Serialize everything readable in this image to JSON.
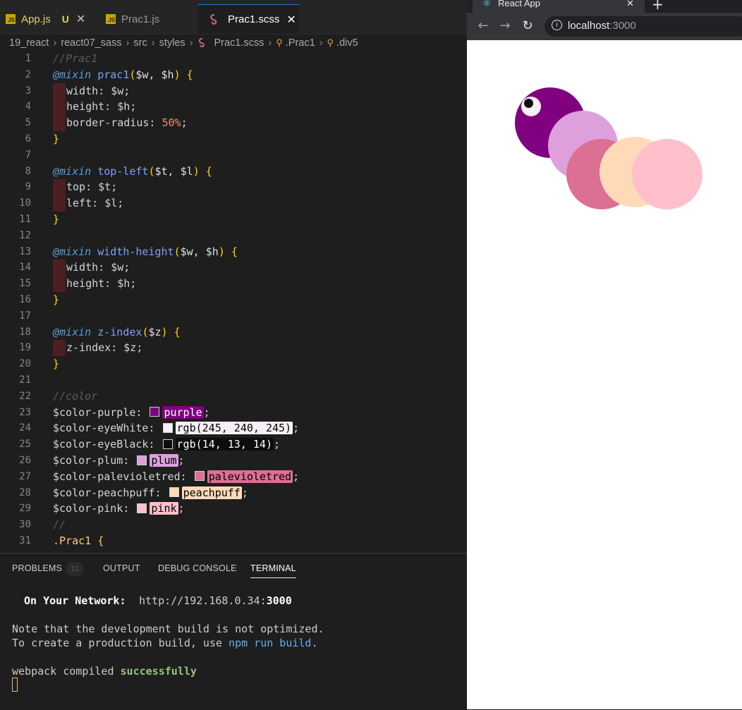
{
  "editor": {
    "tabs": [
      {
        "label": "App.js",
        "status": "U"
      },
      {
        "label": "Prac1.js"
      },
      {
        "label": "Prac1.scss"
      }
    ],
    "js_icon_text": "JS",
    "breadcrumb": [
      "19_react",
      "react07_sass",
      "src",
      "styles",
      "Prac1.scss",
      ".Prac1",
      ".div5"
    ],
    "line_numbers": [
      "1",
      "2",
      "3",
      "4",
      "5",
      "6",
      "7",
      "8",
      "9",
      "10",
      "11",
      "12",
      "13",
      "14",
      "15",
      "16",
      "17",
      "18",
      "19",
      "20",
      "21",
      "22",
      "23",
      "24",
      "25",
      "26",
      "27",
      "28",
      "29",
      "30",
      "31"
    ],
    "code": {
      "l1": "//Prac1",
      "l2_at": "@mixin",
      "l2_name": "prac1",
      "l2_params": "$w, $h",
      "l3_prop": "width:",
      "l3_val": "$w;",
      "l4_prop": "height:",
      "l4_val": "$h;",
      "l5_prop": "border-radius:",
      "l5_val": "50%",
      "l8_at": "@mixin",
      "l8_name": "top-left",
      "l8_params": "$t, $l",
      "l9_prop": "top:",
      "l9_val": "$t;",
      "l10_prop": "left:",
      "l10_val": "$l;",
      "l13_at": "@mixin",
      "l13_name": "width-height",
      "l13_params": "$w, $h",
      "l14_prop": "width:",
      "l14_val": "$w;",
      "l15_prop": "height:",
      "l15_val": "$h;",
      "l18_at": "@mixin",
      "l18_name": "z-index",
      "l18_params": "$z",
      "l19_prop": "z-index:",
      "l19_val": "$z;",
      "l22": "//color",
      "colors": [
        {
          "name": "$color-purple:",
          "value": "purple",
          "swatch": "#800080",
          "chip_bg": "#800080",
          "chip_fg": "#ffffff"
        },
        {
          "name": "$color-eyeWhite:",
          "value": "rgb(245, 240, 245)",
          "swatch": "#f5f0f5",
          "chip_bg": "#f5f0f5",
          "chip_fg": "#000000"
        },
        {
          "name": "$color-eyeBlack:",
          "value": "rgb(14, 13, 14)",
          "swatch": "#0e0d0e",
          "chip_bg": "#0e0d0e",
          "chip_fg": "#ffffff"
        },
        {
          "name": "$color-plum:",
          "value": "plum",
          "swatch": "#dda0dd",
          "chip_bg": "#dda0dd",
          "chip_fg": "#000000"
        },
        {
          "name": "$color-palevioletred:",
          "value": "palevioletred",
          "swatch": "#db7093",
          "chip_bg": "#db7093",
          "chip_fg": "#000000"
        },
        {
          "name": "$color-peachpuff:",
          "value": "peachpuff",
          "swatch": "#ffdab9",
          "chip_bg": "#ffdab9",
          "chip_fg": "#000000"
        },
        {
          "name": "$color-pink:",
          "value": "pink",
          "swatch": "#ffc0cb",
          "chip_bg": "#ffc0cb",
          "chip_fg": "#000000"
        }
      ],
      "l30": "//",
      "l31": ".Prac1 {"
    }
  },
  "panel": {
    "tabs": [
      "PROBLEMS",
      "OUTPUT",
      "DEBUG CONSOLE",
      "TERMINAL"
    ],
    "problems_count": "11",
    "terminal": {
      "network_label": "On Your Network:",
      "network_url_prefix": "http://192.168.0.34:",
      "network_port": "3000",
      "note1": "Note that the development build is not optimized.",
      "note2_prefix": "To create a production build, use ",
      "note2_cmd": "npm run build",
      "note2_suffix": ".",
      "compiled_prefix": "webpack compiled ",
      "compiled_status": "successfully"
    }
  },
  "browser": {
    "tab_title": "React App",
    "new_tab": "+",
    "tab_close": "✕",
    "url_host": "localhost",
    "url_port": ":3000",
    "caterpillar": [
      {
        "segment": "head",
        "color": "#800080"
      },
      {
        "segment": "body-1",
        "color": "#dda0dd"
      },
      {
        "segment": "body-2",
        "color": "#db7093"
      },
      {
        "segment": "body-3",
        "color": "#ffdab9"
      },
      {
        "segment": "body-4",
        "color": "#ffc0cb"
      }
    ],
    "eye_white": "#f5f0f5",
    "eye_black": "#0e0d0e"
  }
}
